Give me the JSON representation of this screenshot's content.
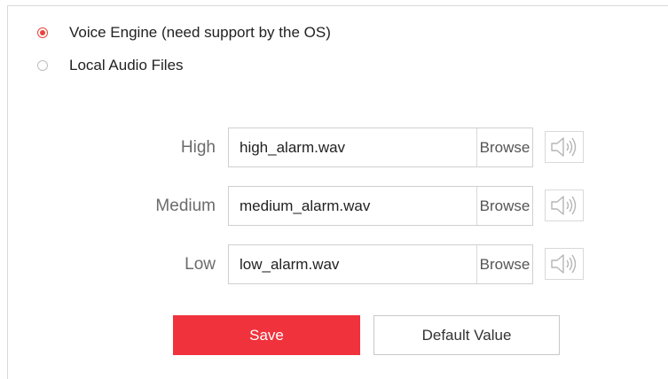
{
  "source_options": [
    {
      "label": "Voice Engine (need support by the OS)",
      "selected": true
    },
    {
      "label": "Local Audio Files",
      "selected": false
    }
  ],
  "audio_files": [
    {
      "level": "High",
      "file": "high_alarm.wav",
      "browse_label": "Browse",
      "icon": "speaker-icon"
    },
    {
      "level": "Medium",
      "file": "medium_alarm.wav",
      "browse_label": "Browse",
      "icon": "speaker-icon"
    },
    {
      "level": "Low",
      "file": "low_alarm.wav",
      "browse_label": "Browse",
      "icon": "speaker-icon"
    }
  ],
  "actions": {
    "save_label": "Save",
    "default_label": "Default Value"
  },
  "colors": {
    "accent": "#f0323c",
    "radio_selected": "#e8453c",
    "border": "#cfcfcf",
    "label_gray": "#6b6b6b"
  }
}
